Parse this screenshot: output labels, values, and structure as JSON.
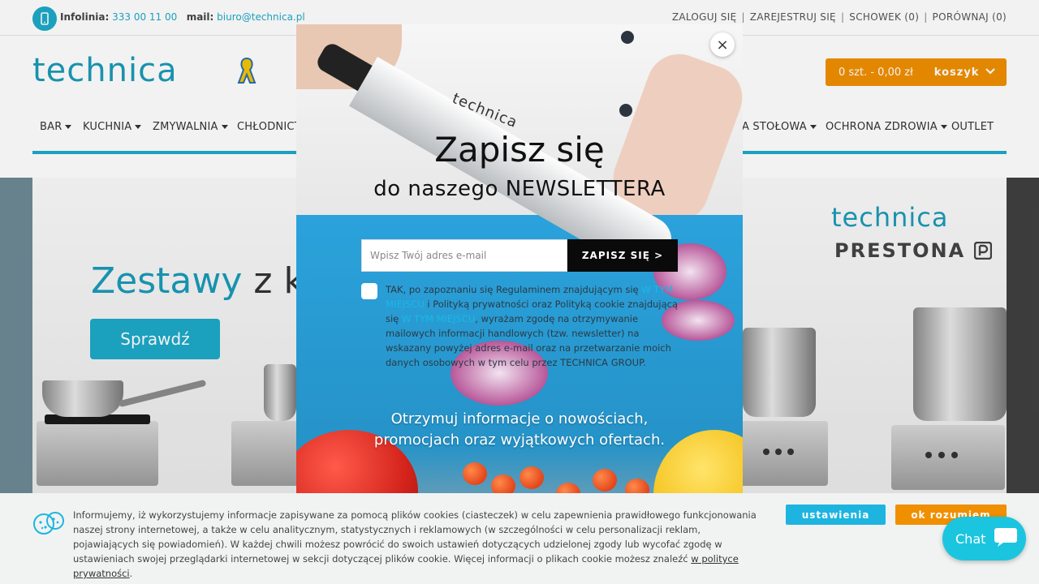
{
  "topbar": {
    "infolinia_label": "Infolinia:",
    "phone": "333 00 11 00",
    "mail_label": "mail:",
    "email": "biuro@technica.pl",
    "links": [
      "ZALOGUJ SIĘ",
      "ZAREJESTRUJ SIĘ",
      "SCHOWEK (0)",
      "PORÓWNAJ (0)"
    ]
  },
  "header": {
    "logo": "technica",
    "cart_amount": "0 szt. - 0,00 zł",
    "cart_label": "koszyk"
  },
  "nav": {
    "items": [
      "BAR",
      "KUCHNIA",
      "ZMYWALNIA",
      "CHŁODNICT",
      "A STOŁOWA",
      "OCHRONA ZDROWIA",
      "OUTLET"
    ]
  },
  "hero": {
    "title_accent": "Zestawy",
    "title_rest": " z ku",
    "button": "Sprawdź",
    "brand1": "technica",
    "brand2": "PRESTONA"
  },
  "modal": {
    "close": "×",
    "knife_brand": "technica",
    "title": "Zapisz się",
    "subtitle": "do naszego NEWSLETTERA",
    "email_placeholder": "Wpisz Twój adres e-mail",
    "submit": "ZAPISZ SIĘ >",
    "consent_part1": "TAK, po zapoznaniu się Regulaminem znajdującym się ",
    "consent_link1": "W TYM MIEJSCU",
    "consent_part2": " i Polityką prywatności oraz Polityką cookie znajdującą się ",
    "consent_link2": "W TYM MIEJSCU",
    "consent_part3": ", wyrażam zgodę na otrzymywanie mailowych informacji handlowych (tzw. newsletter) na wskazany powyżej adres e-mail oraz na przetwarzanie moich danych osobowych w tym celu przez TECHNICA GROUP.",
    "promo_line1": "Otrzymuj informacje o nowościach,",
    "promo_line2": "promocjach oraz wyjątkowych ofertach."
  },
  "cookie": {
    "text": "Informujemy, iż wykorzystujemy informacje zapisywane za pomocą plików cookies (ciasteczek) w celu zapewnienia prawidłowego funkcjonowania naszej strony internetowej, a także w celu analitycznym, statystycznych i reklamowych (w szczególności w celu personalizacji reklam, pojawiających się powiadomień). W każdej chwili możesz powrócić do swoich ustawień dotyczących udzielonej zgody lub wycofać zgodę w ustawieniach swojej przeglądarki internetowej w sekcji dotyczącej plików cookie. Więcej informacji o plikach cookie możesz znaleźć ",
    "link": "w polityce prywatności",
    "settings_button": "ustawienia",
    "ok_button": "ok rozumiem"
  },
  "chat": {
    "label": "Chat"
  },
  "colors": {
    "brand_blue": "#1da9c9",
    "accent_orange": "#f08f00"
  }
}
